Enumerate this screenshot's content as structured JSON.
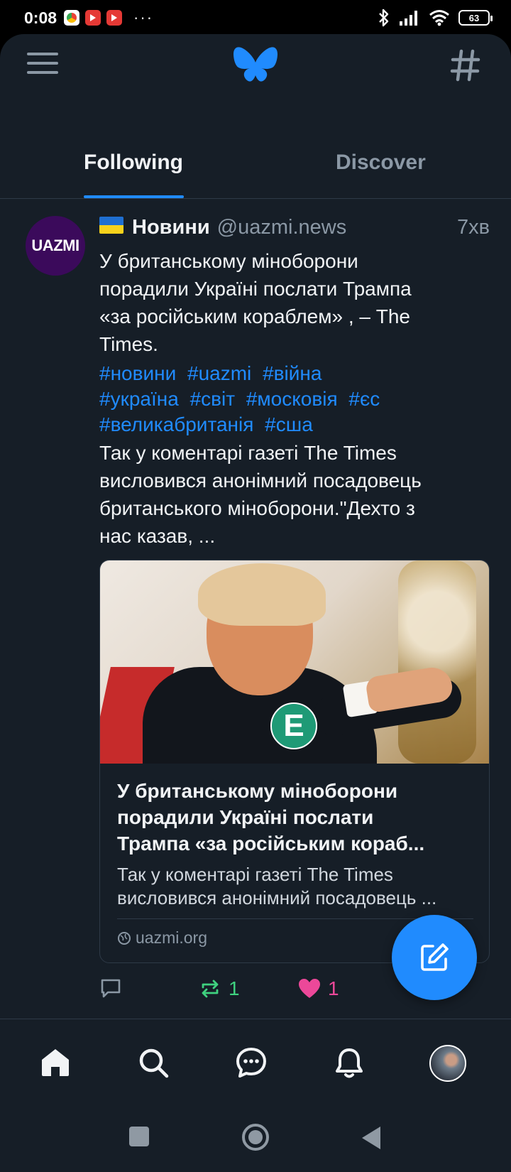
{
  "status_bar": {
    "time": "0:08",
    "more": "···",
    "battery": "63"
  },
  "header": {
    "menu_icon": "menu-icon",
    "logo_icon": "bluesky-butterfly-logo",
    "feeds_icon": "hash-icon"
  },
  "tabs": [
    {
      "label": "Following",
      "active": true
    },
    {
      "label": "Discover",
      "active": false
    }
  ],
  "post": {
    "avatar_text": "UAZMI",
    "author": "Новини",
    "handle": "@uazmi.news",
    "time": "7хв",
    "text_lines": [
      "У британському міноборони",
      "порадили Україні послати Трампа",
      "«за російським кораблем» , – The",
      "Times."
    ],
    "tags_line1": [
      "#новини",
      "#uazmi",
      "#війна"
    ],
    "tags_line2": [
      "#україна",
      "#світ",
      "#московія",
      "#єс"
    ],
    "tags_line3": [
      "#великабританія",
      "#сша"
    ],
    "text2_lines": [
      "Так у коментарі газеті The Times",
      "висловився анонімний посадовець",
      "британського міноборони.\"Дехто з",
      "нас казав, ..."
    ],
    "card": {
      "badge": "Е",
      "title_lines": [
        "У британському міноборони",
        "порадили Україні послати",
        "Трампа  «за російським кораб..."
      ],
      "desc_lines": [
        "Так у коментарі газеті The Times",
        "висловився анонімний посадовець ..."
      ],
      "domain": "uazmi.org"
    },
    "reposts": "1",
    "likes": "1"
  },
  "colors": {
    "accent": "#208bfe",
    "background": "#161e27",
    "repost": "#3fd17f",
    "like": "#ec4899",
    "muted": "#8b98a5"
  },
  "bottom_nav": [
    "home-icon",
    "search-icon",
    "chat-icon",
    "bell-icon",
    "profile-avatar"
  ]
}
